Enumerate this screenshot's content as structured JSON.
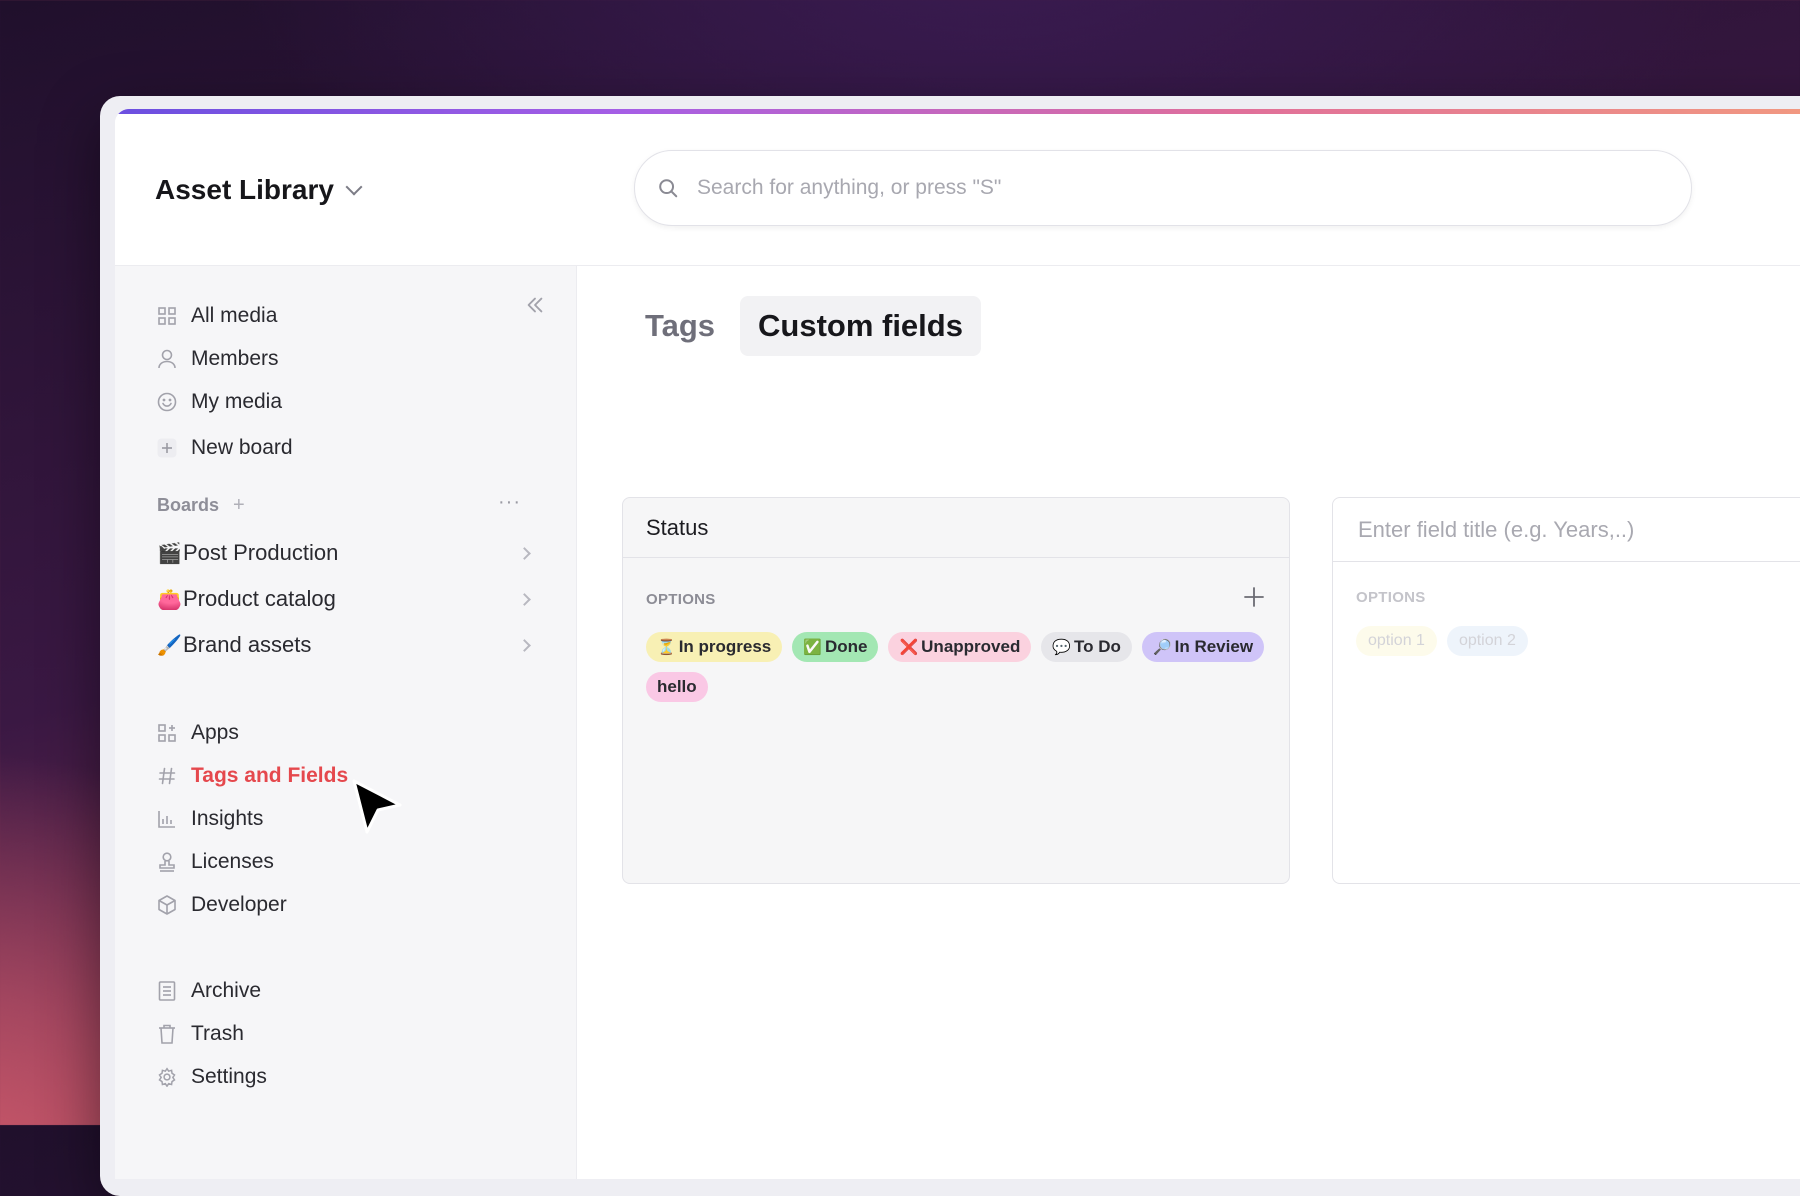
{
  "header": {
    "workspace_title": "Asset Library",
    "search_placeholder": "Search for anything, or press \"S\""
  },
  "sidebar": {
    "primary": [
      {
        "label": "All media",
        "icon": "grid-icon"
      },
      {
        "label": "Members",
        "icon": "person-icon"
      },
      {
        "label": "My media",
        "icon": "smiley-icon"
      },
      {
        "label": "New board",
        "icon": "plus-icon"
      }
    ],
    "boards_label": "Boards",
    "boards": [
      {
        "emoji": "🎬",
        "label": "Post Production"
      },
      {
        "emoji": "👛",
        "label": "Product catalog"
      },
      {
        "emoji": "🖌️",
        "label": "Brand assets"
      }
    ],
    "secondary": [
      {
        "label": "Apps",
        "icon": "apps-icon"
      },
      {
        "label": "Tags and Fields",
        "icon": "hash-icon",
        "active": true
      },
      {
        "label": "Insights",
        "icon": "bar-chart-icon"
      },
      {
        "label": "Licenses",
        "icon": "stamp-icon"
      },
      {
        "label": "Developer",
        "icon": "cube-icon"
      }
    ],
    "tertiary": [
      {
        "label": "Archive",
        "icon": "archive-icon"
      },
      {
        "label": "Trash",
        "icon": "trash-icon"
      },
      {
        "label": "Settings",
        "icon": "gear-icon"
      }
    ]
  },
  "tabs": [
    {
      "label": "Tags",
      "active": false
    },
    {
      "label": "Custom fields",
      "active": true
    }
  ],
  "status_field": {
    "title": "Status",
    "options_label": "OPTIONS",
    "options": [
      {
        "emoji": "⏳",
        "label": "In progress",
        "color": "#f8f0b4"
      },
      {
        "emoji": "✅",
        "label": "Done",
        "color": "#a3e7b3"
      },
      {
        "emoji": "❌",
        "label": "Unapproved",
        "color": "#fbd2df"
      },
      {
        "emoji": "💬",
        "label": "To Do",
        "color": "#e6e6ea"
      },
      {
        "emoji": "🔎",
        "label": "In Review",
        "color": "#cfc4f8"
      },
      {
        "emoji": "",
        "label": "hello",
        "color": "#fac8e5"
      }
    ]
  },
  "new_field": {
    "title_placeholder": "Enter field title (e.g. Years,..)",
    "options_label": "OPTIONS",
    "options": [
      {
        "label": "option 1",
        "color": "#fdfbeb"
      },
      {
        "label": "option 2",
        "color": "#eef4fb"
      }
    ]
  },
  "colors": {
    "active_nav": "#e5484d",
    "accent_start": "#6b4fe0",
    "accent_end": "#f29a7f"
  }
}
